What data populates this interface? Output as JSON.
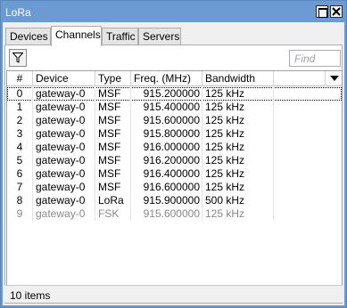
{
  "window": {
    "title": "LoRa"
  },
  "tabs": [
    {
      "label": "Devices"
    },
    {
      "label": "Channels"
    },
    {
      "label": "Traffic"
    },
    {
      "label": "Servers"
    }
  ],
  "toolbar": {
    "filter_icon": "filter-icon",
    "find_placeholder": "Find"
  },
  "table": {
    "columns": [
      "#",
      "Device",
      "Type",
      "Freq. (MHz)",
      "Bandwidth"
    ],
    "rows": [
      {
        "num": "0",
        "device": "gateway-0",
        "type": "MSF",
        "freq": "915.200000",
        "bandwidth": "125 kHz",
        "disabled": false
      },
      {
        "num": "1",
        "device": "gateway-0",
        "type": "MSF",
        "freq": "915.400000",
        "bandwidth": "125 kHz",
        "disabled": false
      },
      {
        "num": "2",
        "device": "gateway-0",
        "type": "MSF",
        "freq": "915.600000",
        "bandwidth": "125 kHz",
        "disabled": false
      },
      {
        "num": "3",
        "device": "gateway-0",
        "type": "MSF",
        "freq": "915.800000",
        "bandwidth": "125 kHz",
        "disabled": false
      },
      {
        "num": "4",
        "device": "gateway-0",
        "type": "MSF",
        "freq": "916.000000",
        "bandwidth": "125 kHz",
        "disabled": false
      },
      {
        "num": "5",
        "device": "gateway-0",
        "type": "MSF",
        "freq": "916.200000",
        "bandwidth": "125 kHz",
        "disabled": false
      },
      {
        "num": "6",
        "device": "gateway-0",
        "type": "MSF",
        "freq": "916.400000",
        "bandwidth": "125 kHz",
        "disabled": false
      },
      {
        "num": "7",
        "device": "gateway-0",
        "type": "MSF",
        "freq": "916.600000",
        "bandwidth": "125 kHz",
        "disabled": false
      },
      {
        "num": "8",
        "device": "gateway-0",
        "type": "LoRa",
        "freq": "915.900000",
        "bandwidth": "500 kHz",
        "disabled": false
      },
      {
        "num": "9",
        "device": "gateway-0",
        "type": "FSK",
        "freq": "915.600000",
        "bandwidth": "125 kHz",
        "disabled": true
      }
    ]
  },
  "status": {
    "items_count": "10 items"
  },
  "colors": {
    "titlebar": "#6c9bd3",
    "disabled_text": "#8a8a8a"
  }
}
